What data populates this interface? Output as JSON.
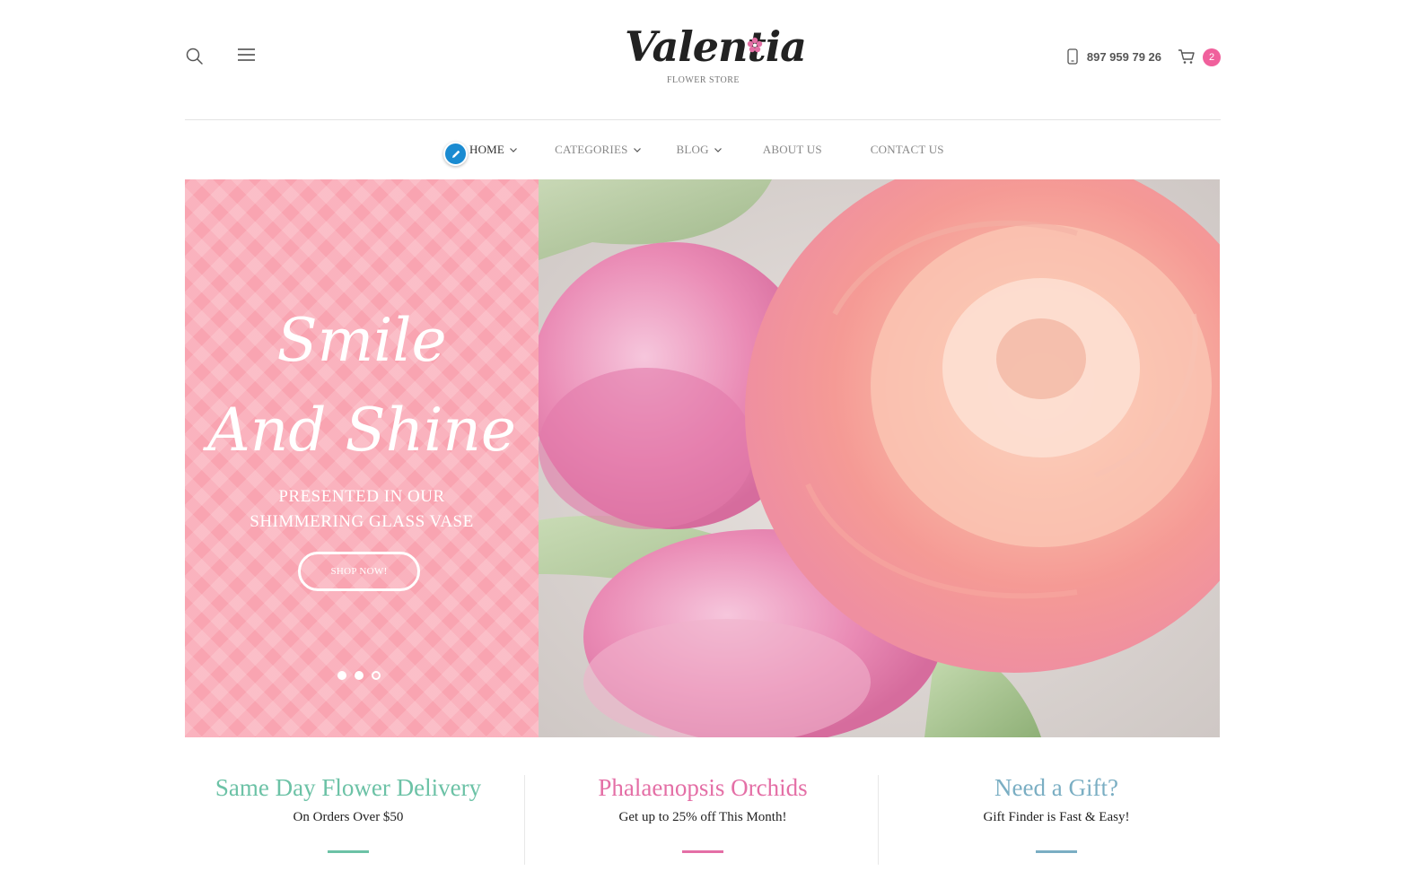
{
  "header": {
    "logo_text": "Valentia",
    "logo_subtitle": "FLOWER STORE",
    "phone_number": "897 959 79 26",
    "cart_count": "2"
  },
  "nav": {
    "items": [
      {
        "label": "HOME",
        "has_dropdown": true,
        "active": true
      },
      {
        "label": "CATEGORIES",
        "has_dropdown": true,
        "active": false
      },
      {
        "label": "BLOG",
        "has_dropdown": true,
        "active": false
      },
      {
        "label": "ABOUT US",
        "has_dropdown": false,
        "active": false
      },
      {
        "label": "CONTACT US",
        "has_dropdown": false,
        "active": false
      }
    ]
  },
  "hero": {
    "title_line1": "Smile",
    "title_line2": "And Shine",
    "subtitle_line1": "PRESENTED IN OUR",
    "subtitle_line2": "SHIMMERING GLASS VASE",
    "button_label": "SHOP NOW!",
    "slides_total": 3,
    "active_slide": 3,
    "background_color": "#f9a4b1"
  },
  "promos": [
    {
      "title": "Same Day Flower Delivery",
      "subtitle": "On Orders Over $50",
      "color": "#6cc2a6"
    },
    {
      "title": "Phalaenopsis Orchids",
      "subtitle": "Get up to 25% off This Month!",
      "color": "#e46fa6"
    },
    {
      "title": "Need a Gift?",
      "subtitle": "Gift Finder is Fast & Easy!",
      "color": "#7aaec3"
    }
  ],
  "icons": {
    "search": "search-icon",
    "menu": "hamburger-menu-icon",
    "phone": "mobile-phone-icon",
    "cart": "shopping-cart-icon",
    "edit": "pencil-icon"
  },
  "colors": {
    "accent_pink": "#f0609c",
    "edit_blue": "#1a8bd1"
  }
}
